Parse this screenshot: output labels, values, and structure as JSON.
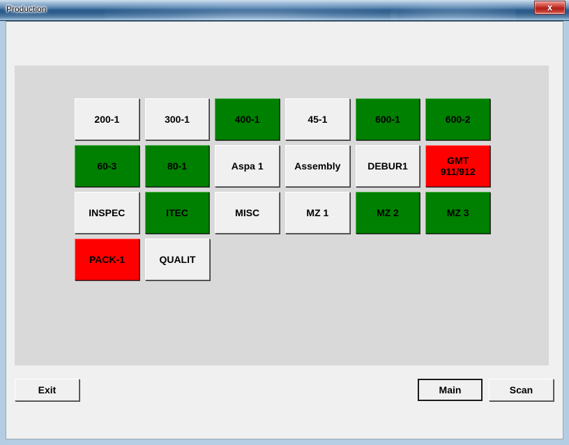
{
  "window": {
    "title": "Production",
    "close_label": "x",
    "close_icon": "close-icon"
  },
  "colors": {
    "green": "#008000",
    "red": "#FF0000",
    "default": "#F0F0F0",
    "panel": "#D9D9D9",
    "form": "#F0F0F0",
    "title_blue": "#1E4F80"
  },
  "grid": {
    "rows": [
      [
        {
          "label": "200-1",
          "state": "default"
        },
        {
          "label": "300-1",
          "state": "default"
        },
        {
          "label": "400-1",
          "state": "green"
        },
        {
          "label": "45-1",
          "state": "default"
        },
        {
          "label": "600-1",
          "state": "green"
        },
        {
          "label": "600-2",
          "state": "green"
        }
      ],
      [
        {
          "label": "60-3",
          "state": "green"
        },
        {
          "label": "80-1",
          "state": "green"
        },
        {
          "label": "Aspa 1",
          "state": "default"
        },
        {
          "label": "Assembly",
          "state": "default"
        },
        {
          "label": "DEBUR1",
          "state": "default"
        },
        {
          "label": "GMT\n911/912",
          "state": "red"
        }
      ],
      [
        {
          "label": "INSPEC",
          "state": "default"
        },
        {
          "label": "ITEC",
          "state": "green"
        },
        {
          "label": "MISC",
          "state": "default"
        },
        {
          "label": "MZ 1",
          "state": "default"
        },
        {
          "label": "MZ 2",
          "state": "green"
        },
        {
          "label": "MZ 3",
          "state": "green"
        }
      ],
      [
        {
          "label": "PACK-1",
          "state": "red"
        },
        {
          "label": "QUALIT",
          "state": "default"
        }
      ]
    ]
  },
  "footer": {
    "exit_label": "Exit",
    "main_label": "Main",
    "scan_label": "Scan"
  }
}
